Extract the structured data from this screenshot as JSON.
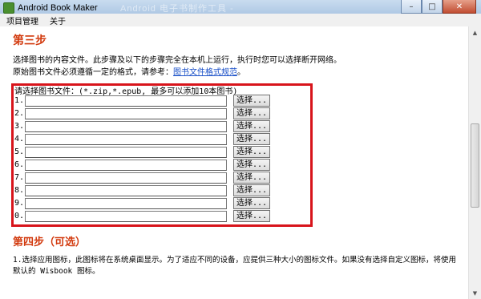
{
  "window": {
    "title": "Android Book Maker",
    "ghost_title": "Android 电子书制作工具 - ",
    "minimize_glyph": "–",
    "maximize_glyph": "□",
    "close_glyph": "✕"
  },
  "menubar": {
    "items": [
      "项目管理",
      "关于"
    ]
  },
  "step3": {
    "heading": "第三步",
    "desc_line1": "选择图书的内容文件。此步骤及以下的步骤完全在本机上运行，执行时您可以选择断开网络。",
    "desc_line2_prefix": "原始图书文件必须遵循一定的格式，请参考：",
    "format_link": "图书文件格式规范",
    "desc_line2_suffix": "。",
    "files_prompt": "请选择图书文件：(*.zip,*.epub, 最多可以添加10本图书)",
    "file_rows": [
      {
        "num": "1.",
        "value": "",
        "button": "选择..."
      },
      {
        "num": "2.",
        "value": "",
        "button": "选择..."
      },
      {
        "num": "3.",
        "value": "",
        "button": "选择..."
      },
      {
        "num": "4.",
        "value": "",
        "button": "选择..."
      },
      {
        "num": "5.",
        "value": "",
        "button": "选择..."
      },
      {
        "num": "6.",
        "value": "",
        "button": "选择..."
      },
      {
        "num": "7.",
        "value": "",
        "button": "选择..."
      },
      {
        "num": "8.",
        "value": "",
        "button": "选择..."
      },
      {
        "num": "9.",
        "value": "",
        "button": "选择..."
      },
      {
        "num": "0.",
        "value": "",
        "button": "选择..."
      }
    ]
  },
  "step4": {
    "heading": "第四步（可选）",
    "icon_desc": "1.选择应用图标，此图标将在系统桌面显示。为了适应不同的设备，应提供三种大小的图标文件。如果没有选择自定义图标，将使用默认的 Wisbook 图标。"
  },
  "scrollbar": {
    "up_glyph": "▲",
    "down_glyph": "▼"
  },
  "colors": {
    "heading": "#d23a0e",
    "highlight_box": "#d8141b",
    "link": "#1a50c8"
  }
}
